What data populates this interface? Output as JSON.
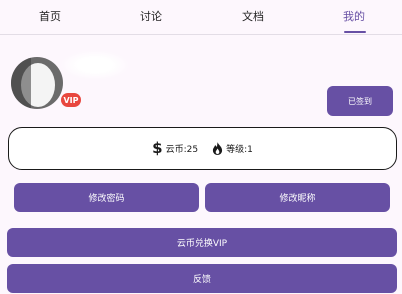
{
  "tabs": [
    {
      "label": "首页",
      "active": false
    },
    {
      "label": "讨论",
      "active": false
    },
    {
      "label": "文档",
      "active": false
    },
    {
      "label": "我的",
      "active": true
    }
  ],
  "profile": {
    "vip_badge": "VIP"
  },
  "signin_button": "已签到",
  "stats": {
    "coins_label": "云币:25",
    "level_label": "等级:1"
  },
  "actions": {
    "change_password": "修改密码",
    "change_nickname": "修改昵称",
    "redeem_vip": "云币兑换VIP",
    "feedback": "反馈"
  },
  "colors": {
    "accent": "#6750a4",
    "vip_badge": "#e8473f",
    "background": "#fdf7fd"
  }
}
